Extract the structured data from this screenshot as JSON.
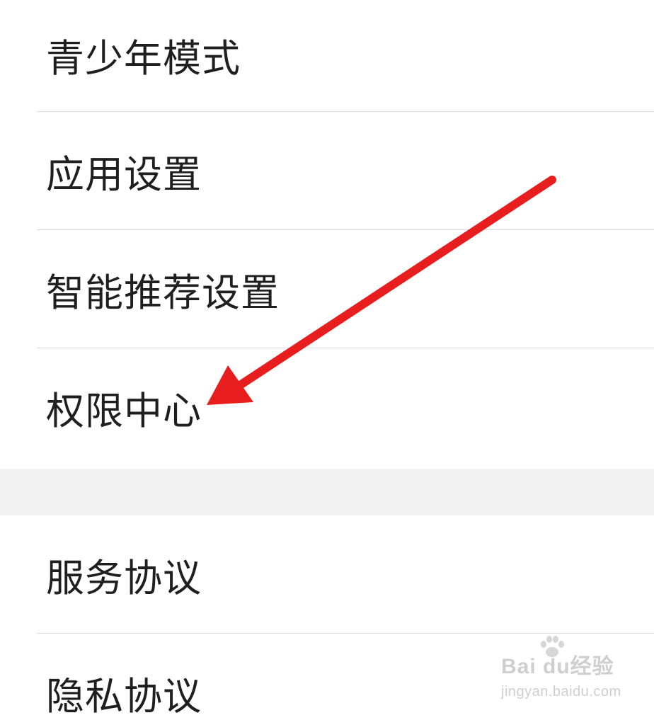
{
  "settings": {
    "group1": [
      {
        "label": "青少年模式"
      },
      {
        "label": "应用设置"
      },
      {
        "label": "智能推荐设置"
      },
      {
        "label": "权限中心"
      }
    ],
    "group2": [
      {
        "label": "服务协议"
      },
      {
        "label": "隐私协议"
      }
    ]
  },
  "annotation": {
    "arrow_color": "#e81e1e",
    "arrow_target": "权限中心"
  },
  "watermark": {
    "logo": "Bai du经验",
    "url": "jingyan.baidu.com"
  }
}
